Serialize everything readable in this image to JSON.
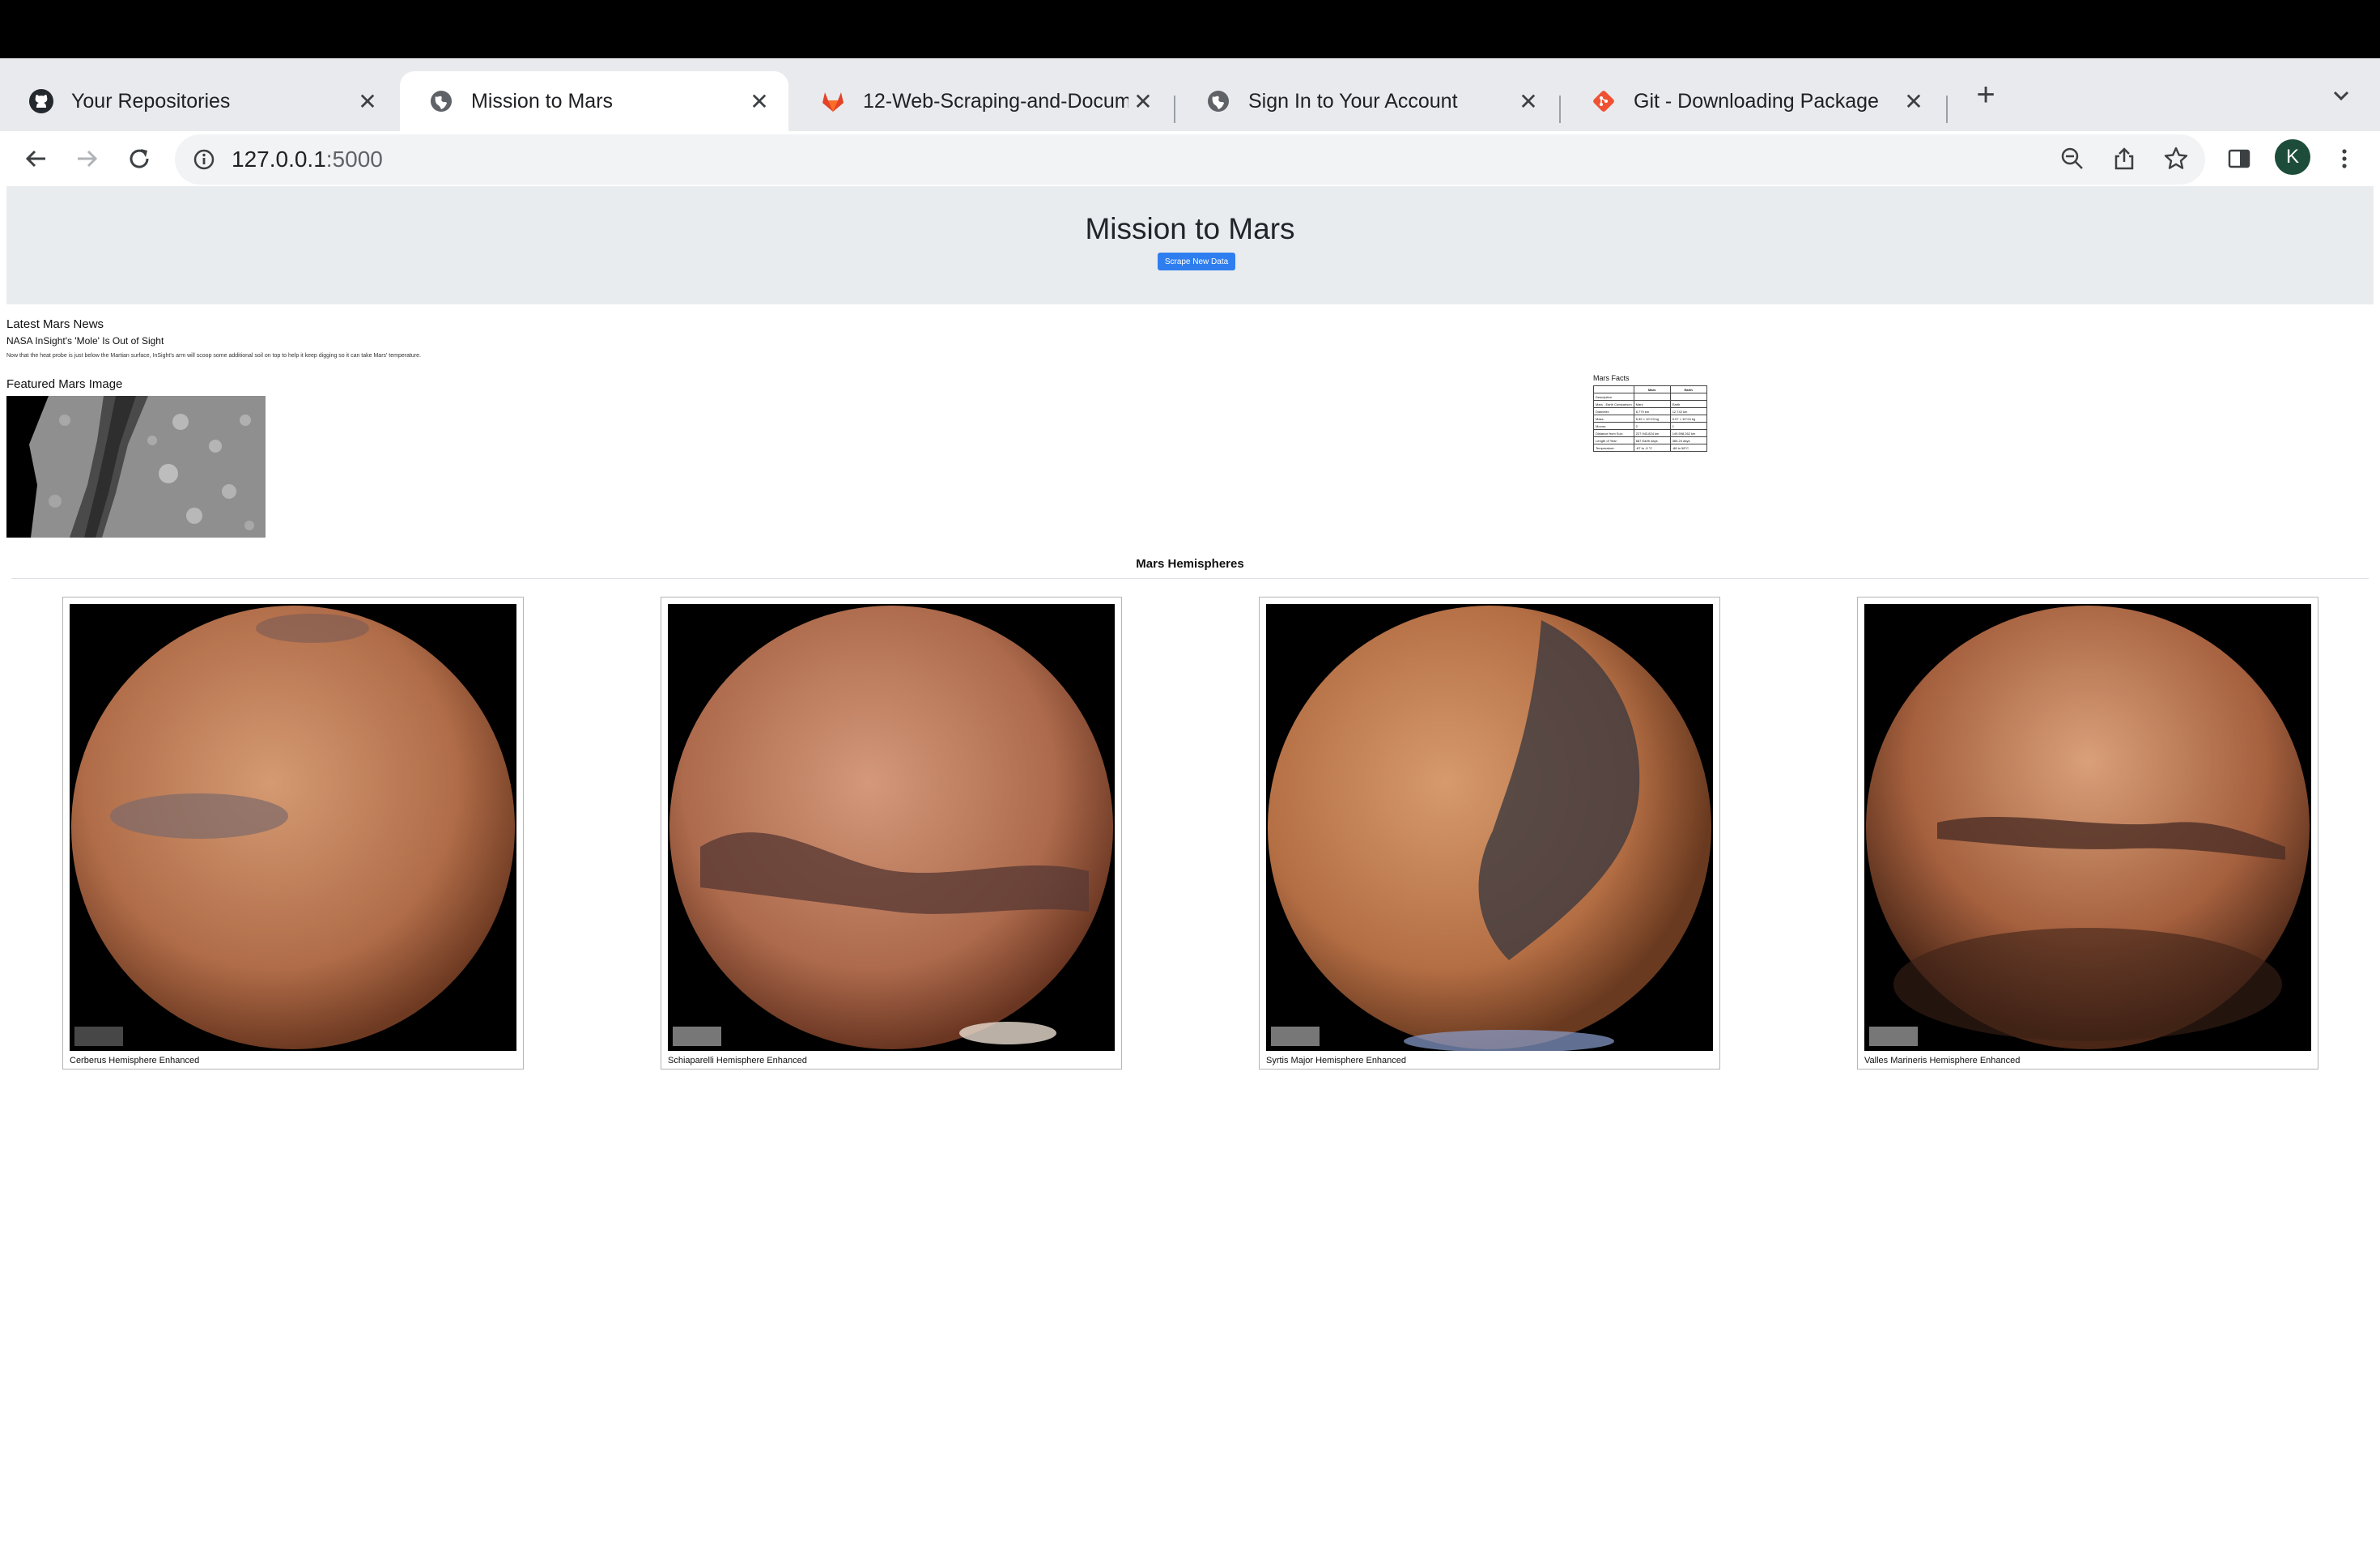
{
  "browser": {
    "tabs": [
      {
        "title": "Your Repositories",
        "icon": "github-icon"
      },
      {
        "title": "Mission to Mars",
        "icon": "globe-icon",
        "active": true
      },
      {
        "title": "12-Web-Scraping-and-Docum",
        "icon": "gitlab-icon"
      },
      {
        "title": "Sign In to Your Account",
        "icon": "globe-icon"
      },
      {
        "title": "Git - Downloading Package",
        "icon": "git-icon"
      }
    ],
    "url_host": "127.0.0.1",
    "url_port": ":5000",
    "avatar_letter": "K"
  },
  "page": {
    "title": "Mission to Mars",
    "scrape_button": "Scrape New Data",
    "news": {
      "heading": "Latest Mars News",
      "title": "NASA InSight's 'Mole' Is Out of Sight",
      "paragraph": "Now that the heat probe is just below the Martian surface, InSight's arm will scoop some additional soil on top to help it keep digging so it can take Mars' temperature."
    },
    "featured": {
      "heading": "Featured Mars Image"
    },
    "facts": {
      "label": "Mars Facts",
      "headers": [
        "",
        "Mars",
        "Earth"
      ],
      "rows": [
        [
          "Description",
          "",
          ""
        ],
        [
          "Mars - Earth Comparison",
          "Mars",
          "Earth"
        ],
        [
          "Diameter:",
          "6,779 km",
          "12,742 km"
        ],
        [
          "Mass:",
          "6.39 × 10^23 kg",
          "5.97 × 10^24 kg"
        ],
        [
          "Moons:",
          "2",
          "1"
        ],
        [
          "Distance from Sun:",
          "227,943,824 km",
          "149,598,262 km"
        ],
        [
          "Length of Year:",
          "687 Earth days",
          "365.24 days"
        ],
        [
          "Temperature:",
          "-87 to -5 °C",
          "-88 to 58°C"
        ]
      ]
    },
    "hemispheres": {
      "heading": "Mars Hemispheres",
      "items": [
        {
          "title": "Cerberus Hemisphere Enhanced"
        },
        {
          "title": "Schiaparelli Hemisphere Enhanced"
        },
        {
          "title": "Syrtis Major Hemisphere Enhanced"
        },
        {
          "title": "Valles Marineris Hemisphere Enhanced"
        }
      ]
    }
  }
}
